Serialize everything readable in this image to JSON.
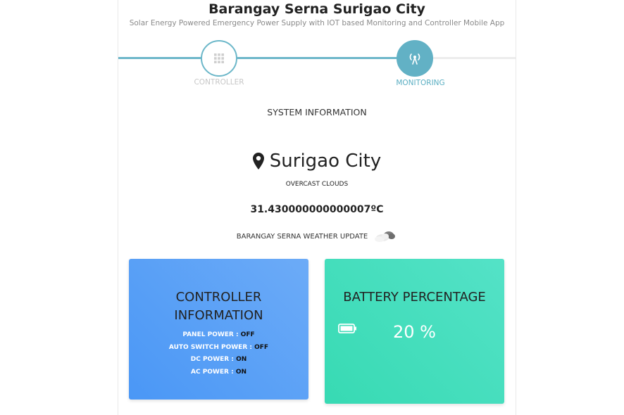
{
  "header": {
    "title": "Barangay Serna Surigao City",
    "subtitle": "Solar Energy Powered Emergency Power Supply with IOT based Monitoring and Controller Mobile App"
  },
  "stepper": {
    "steps": [
      {
        "label": "CONTROLLER",
        "icon": "grid-icon",
        "state": "inactive"
      },
      {
        "label": "MONITORING",
        "icon": "tower-icon",
        "state": "active"
      }
    ],
    "colors": {
      "active": "#62b1c5",
      "inactive_label": "#c7c7c7"
    }
  },
  "system_info": {
    "section_title": "SYSTEM INFORMATION",
    "location_icon": "map-marker-icon",
    "city": "Surigao City",
    "condition": "OVERCAST CLOUDS",
    "temperature": "31.430000000000007ºC",
    "weather_update_label": "BARANGAY SERNA WEATHER UPDATE",
    "weather_icon": "cloud-icon"
  },
  "controller_card": {
    "title_line1": "CONTROLLER",
    "title_line2": "INFORMATION",
    "items": [
      {
        "label": "PANEL POWER :",
        "value": "OFF"
      },
      {
        "label": "AUTO SWITCH POWER :",
        "value": "OFF"
      },
      {
        "label": "DC POWER :",
        "value": "ON"
      },
      {
        "label": "AC POWER :",
        "value": "ON"
      }
    ],
    "color": "#4a97f6"
  },
  "battery_card": {
    "title": "BATTERY PERCENTAGE",
    "icon": "battery-icon",
    "value": "20 %",
    "color": "#37dab3"
  }
}
